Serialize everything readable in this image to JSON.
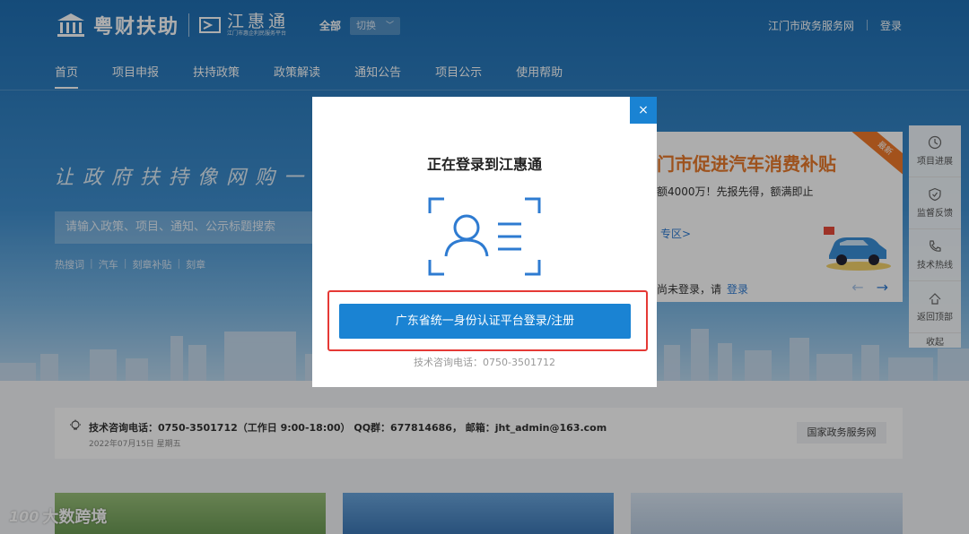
{
  "header": {
    "logo_name": "粤财扶助",
    "brand_name": "江惠通",
    "brand_sub": "江门市惠企利民服务平台",
    "scope_label": "全部",
    "switch_label": "切换",
    "gov_link": "江门市政务服务网",
    "login_link": "登录"
  },
  "nav": {
    "items": [
      {
        "label": "首页",
        "active": true
      },
      {
        "label": "项目申报"
      },
      {
        "label": "扶持政策"
      },
      {
        "label": "政策解读"
      },
      {
        "label": "通知公告"
      },
      {
        "label": "项目公示"
      },
      {
        "label": "使用帮助"
      }
    ]
  },
  "hero": {
    "slogan": "让政府扶持像网购一样",
    "search_placeholder": "请输入政策、项目、通知、公示标题搜索",
    "hot_label": "热搜词",
    "hot_words": [
      "汽车",
      "刻章补贴",
      "刻章"
    ]
  },
  "promo": {
    "title": "门市促进汽车消费补贴",
    "subtitle": "额4000万！先报先得，额满即止",
    "link": "专区>",
    "login_prompt": "尚未登录，请",
    "login_link": "登录",
    "ribbon": "最新"
  },
  "sidetool": {
    "items": [
      "项目进展",
      "监督反馈",
      "技术热线",
      "返回顶部"
    ],
    "collapse": "收起"
  },
  "infobar": {
    "line": "技术咨询电话：0750-3501712（工作日 9:00-18:00） QQ群：677814686， 邮箱：jht_admin@163.com",
    "date": "2022年07月15日 星期五",
    "gov_button": "国家政务服务网"
  },
  "modal": {
    "close": "×",
    "title": "正在登录到江惠通",
    "login_button": "广东省统一身份认证平台登录/注册",
    "phone": "技术咨询电话：0750-3501712"
  },
  "watermark": {
    "logo": "100",
    "text": "大数跨境"
  },
  "colors": {
    "primary": "#1a83d3",
    "highlight": "#e53935",
    "promo_orange": "#e87a2b"
  }
}
